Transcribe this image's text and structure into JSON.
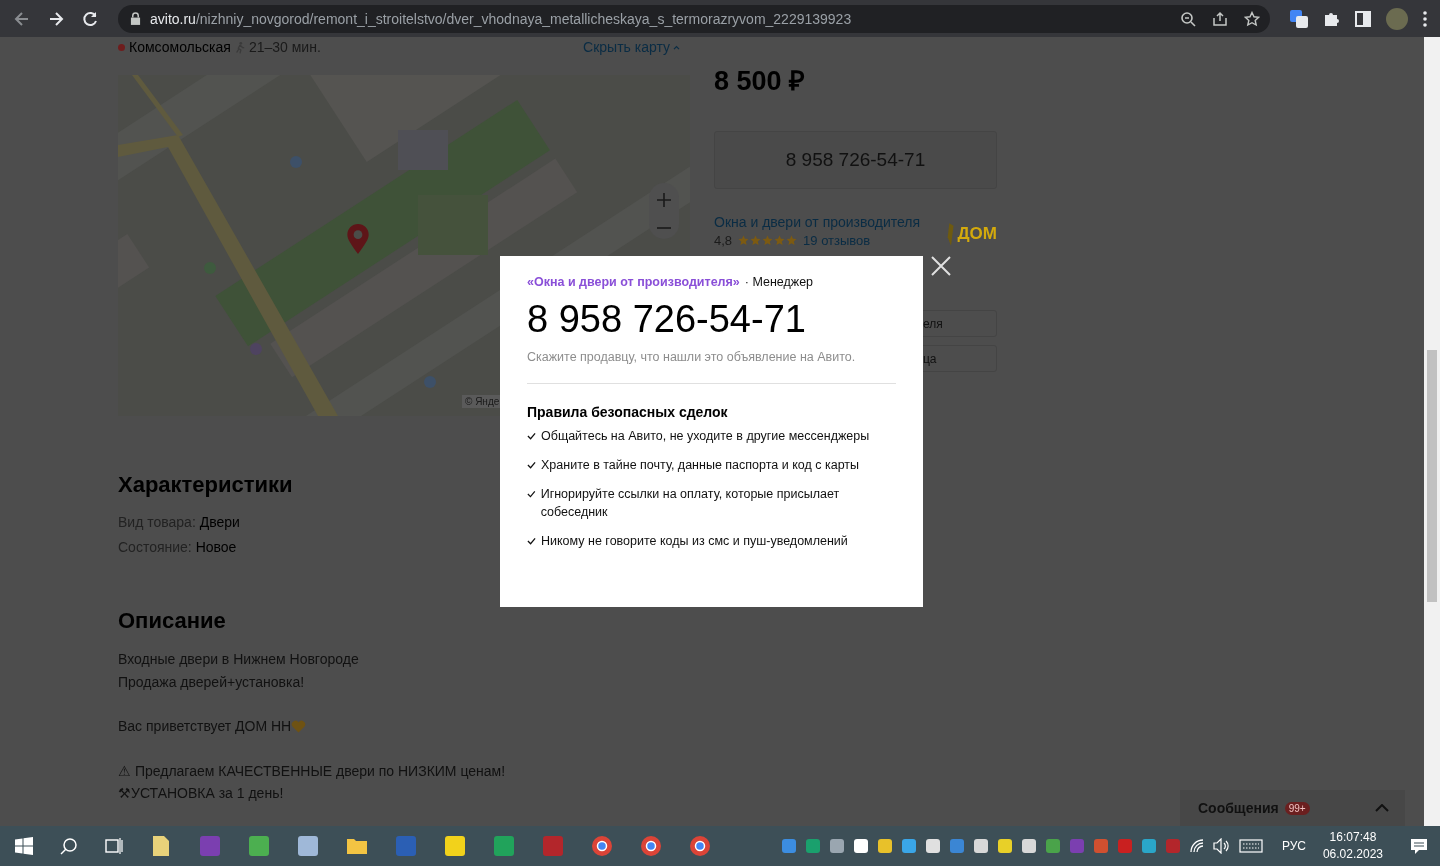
{
  "browser": {
    "url_host": "avito.ru",
    "url_path": "/nizhniy_novgorod/remont_i_stroitelstvo/dver_vhodnaya_metallicheskaya_s_termorazryvom_2229139923"
  },
  "location": {
    "station": "Комсомольская",
    "walk_time": "21–30 мин.",
    "hide_map_link": "Скрыть карту"
  },
  "map": {
    "attribution": "© Янде"
  },
  "characteristics": {
    "title": "Характеристики",
    "rows": [
      {
        "label": "Вид товара:",
        "value": "Двери"
      },
      {
        "label": "Состояние:",
        "value": "Новое"
      }
    ]
  },
  "description": {
    "title": "Описание",
    "paragraphs": [
      [
        {
          "kind": "plain",
          "text": "Входные двери в Нижнем Новгороде"
        },
        {
          "kind": "plain",
          "text": "Продажа дверей+установка!"
        }
      ],
      [
        {
          "kind": "heart",
          "text": "Вас приветствует ДОМ НН"
        }
      ],
      [
        {
          "kind": "plain",
          "text": "⚠ Предлагаем КАЧЕСТВЕННЫЕ двери по НИЗКИМ ценам!"
        },
        {
          "kind": "plain",
          "text": "⚒УСТАНОВКА за 1 день!"
        }
      ]
    ]
  },
  "sidebar": {
    "price": "8 500 ₽",
    "phone_button": "8 958 726-54-71",
    "seller_name": "Окна и двери от производителя",
    "rating": "4,8",
    "stars": 5,
    "reviews": "19 отзывов",
    "logo_text": "ДОМ",
    "buttons": [
      "еля",
      "ца"
    ]
  },
  "modal": {
    "seller": "«Окна и двери от производителя»",
    "role": "· Менеджер",
    "phone": "8 958 726-54-71",
    "hint": "Скажите продавцу, что нашли это объявление на Авито.",
    "rules_title": "Правила безопасных сделок",
    "rules": [
      "Общайтесь на Авито, не уходите в другие мессенджеры",
      "Храните в тайне почту, данные паспорта и код с карты",
      "Игнорируйте ссылки на оплату, которые присылает собеседник",
      "Никому не говорите коды из смс и пуш-уведомлений"
    ]
  },
  "messages": {
    "label": "Сообщения",
    "badge": "99+"
  },
  "taskbar": {
    "language": "РУС",
    "time": "16:07:48",
    "date": "06.02.2023"
  }
}
